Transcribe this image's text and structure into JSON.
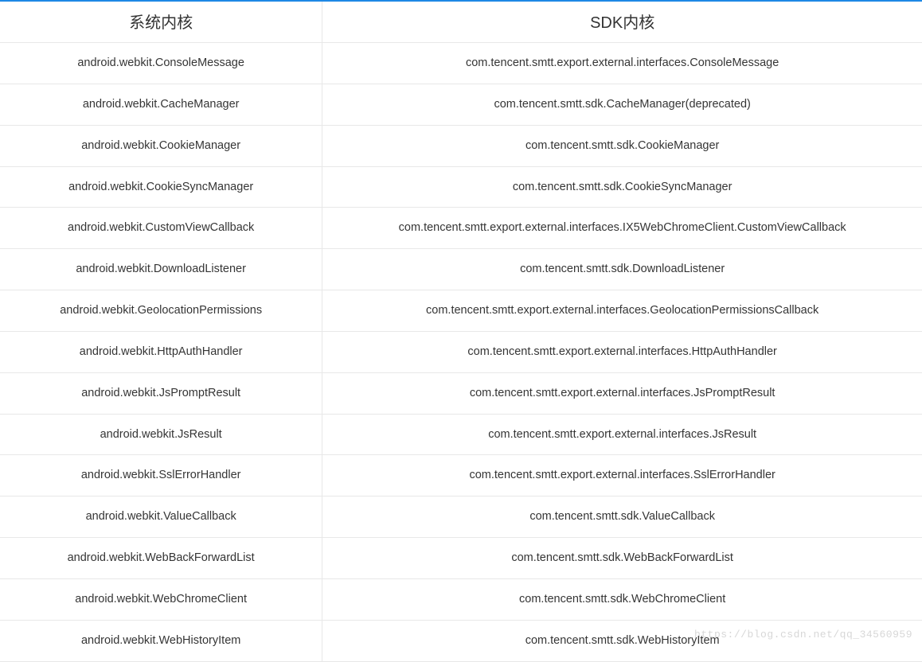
{
  "table": {
    "headers": {
      "system": "系统内核",
      "sdk": "SDK内核"
    },
    "rows": [
      {
        "system": "android.webkit.ConsoleMessage",
        "sdk": "com.tencent.smtt.export.external.interfaces.ConsoleMessage"
      },
      {
        "system": "android.webkit.CacheManager",
        "sdk": "com.tencent.smtt.sdk.CacheManager(deprecated)"
      },
      {
        "system": "android.webkit.CookieManager",
        "sdk": "com.tencent.smtt.sdk.CookieManager"
      },
      {
        "system": "android.webkit.CookieSyncManager",
        "sdk": "com.tencent.smtt.sdk.CookieSyncManager"
      },
      {
        "system": "android.webkit.CustomViewCallback",
        "sdk": "com.tencent.smtt.export.external.interfaces.IX5WebChromeClient.CustomViewCallback"
      },
      {
        "system": "android.webkit.DownloadListener",
        "sdk": "com.tencent.smtt.sdk.DownloadListener"
      },
      {
        "system": "android.webkit.GeolocationPermissions",
        "sdk": "com.tencent.smtt.export.external.interfaces.GeolocationPermissionsCallback"
      },
      {
        "system": "android.webkit.HttpAuthHandler",
        "sdk": "com.tencent.smtt.export.external.interfaces.HttpAuthHandler"
      },
      {
        "system": "android.webkit.JsPromptResult",
        "sdk": "com.tencent.smtt.export.external.interfaces.JsPromptResult"
      },
      {
        "system": "android.webkit.JsResult",
        "sdk": "com.tencent.smtt.export.external.interfaces.JsResult"
      },
      {
        "system": "android.webkit.SslErrorHandler",
        "sdk": "com.tencent.smtt.export.external.interfaces.SslErrorHandler"
      },
      {
        "system": "android.webkit.ValueCallback",
        "sdk": "com.tencent.smtt.sdk.ValueCallback"
      },
      {
        "system": "android.webkit.WebBackForwardList",
        "sdk": "com.tencent.smtt.sdk.WebBackForwardList"
      },
      {
        "system": "android.webkit.WebChromeClient",
        "sdk": "com.tencent.smtt.sdk.WebChromeClient"
      },
      {
        "system": "android.webkit.WebHistoryItem",
        "sdk": "com.tencent.smtt.sdk.WebHistoryItem"
      }
    ]
  },
  "watermark": "https://blog.csdn.net/qq_34560959"
}
